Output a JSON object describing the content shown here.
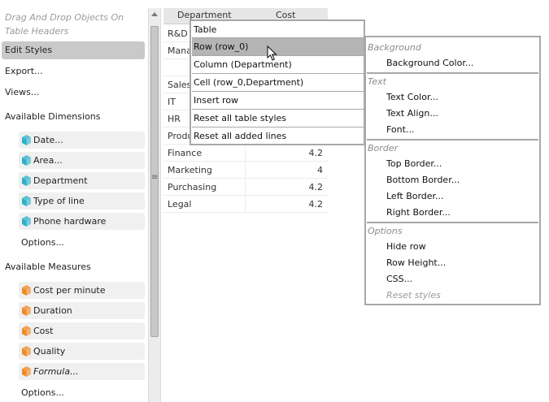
{
  "left_panel": {
    "hint": "Drag And Drop Objects On Table Headers",
    "edit_styles": "Edit Styles",
    "export": "Export...",
    "views": "Views...",
    "dimensions_title": "Available Dimensions",
    "dimensions": [
      {
        "label": "Date...",
        "italic": false
      },
      {
        "label": "Area...",
        "italic": false
      },
      {
        "label": "Department",
        "italic": false
      },
      {
        "label": "Type of line",
        "italic": false
      },
      {
        "label": "Phone hardware",
        "italic": false
      }
    ],
    "dimensions_options": "Options...",
    "measures_title": "Available Measures",
    "measures": [
      {
        "label": "Cost per minute",
        "italic": false
      },
      {
        "label": "Duration",
        "italic": false
      },
      {
        "label": "Cost",
        "italic": false
      },
      {
        "label": "Quality",
        "italic": false
      },
      {
        "label": "Formula...",
        "italic": true
      }
    ],
    "measures_options": "Options..."
  },
  "splitter": {
    "grip": "≡"
  },
  "table": {
    "headers": [
      "Department",
      "Cost"
    ],
    "rows": [
      {
        "dept": "R&D",
        "cost": ""
      },
      {
        "dept": "Mana",
        "cost": ""
      },
      {
        "dept": "",
        "cost": ""
      },
      {
        "dept": "Sales",
        "cost": ""
      },
      {
        "dept": "IT",
        "cost": ""
      },
      {
        "dept": "HR",
        "cost": ""
      },
      {
        "dept": "Produ",
        "cost": ""
      },
      {
        "dept": "Finance",
        "cost": "4.2"
      },
      {
        "dept": "Marketing",
        "cost": "4"
      },
      {
        "dept": "Purchasing",
        "cost": "4.2"
      },
      {
        "dept": "Legal",
        "cost": "4.2"
      }
    ]
  },
  "context_menu": {
    "items": [
      "Table",
      "Row (row_0)",
      "Column (Department)",
      "Cell (row_0,Department)",
      "Insert row",
      "Reset all table styles",
      "Reset all added lines"
    ],
    "highlighted_index": 1
  },
  "submenu": {
    "background_header": "Background",
    "background_color": "Background Color...",
    "text_header": "Text",
    "text_color": "Text Color...",
    "text_align": "Text Align...",
    "font": "Font...",
    "border_header": "Border",
    "top_border": "Top Border...",
    "bottom_border": "Bottom Border...",
    "left_border": "Left Border...",
    "right_border": "Right Border...",
    "options_header": "Options",
    "hide_row": "Hide row",
    "row_height": "Row Height...",
    "css": "CSS...",
    "reset_styles": "Reset styles"
  },
  "colors": {
    "dimension_cube": "#2bb0c8",
    "measure_cube": "#f08a24",
    "highlight": "#b4b4b4",
    "menu_border": "#a8a8a8"
  }
}
